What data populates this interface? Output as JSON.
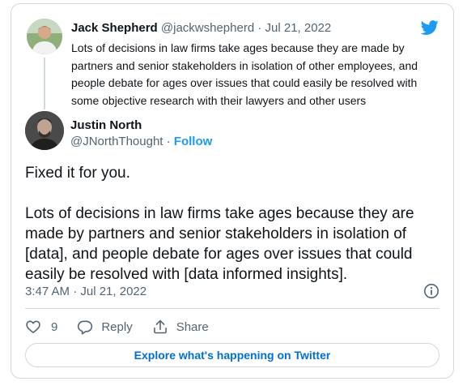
{
  "parent_tweet": {
    "name": "Jack Shepherd",
    "handle": "@jackwshepherd",
    "separator": "·",
    "date": "Jul 21, 2022",
    "text_lines": [
      "Lots of decisions in law firms take ages because they are made by",
      "partners and senior stakeholders in isolation of other employees, and",
      "people debate for ages over issues that could easily be resolved with",
      "some objective research with their lawyers and other users"
    ]
  },
  "main_tweet": {
    "name": "Justin North",
    "handle": "@JNorthThought",
    "separator": "·",
    "follow_label": "Follow",
    "text_lines": [
      "Fixed it for you.",
      "",
      "Lots of decisions in law firms take ages because they are",
      "made by partners and senior stakeholders in isolation of",
      "[data], and people debate for ages over issues that could",
      "easily be resolved with [data informed insights]."
    ],
    "timestamp": "3:47 AM · Jul 21, 2022"
  },
  "actions": {
    "like_count": "9",
    "reply_label": "Reply",
    "share_label": "Share"
  },
  "explore_label": "Explore what's happening on Twitter",
  "icons": {
    "brand": "twitter-bird-icon",
    "info": "info-icon",
    "like": "heart-icon",
    "reply": "reply-bubble-icon",
    "share": "share-upload-icon"
  },
  "colors": {
    "brand_blue": "#1d9bf0",
    "link_blue": "#006fd6",
    "text": "#0f1419",
    "muted": "#536471",
    "border": "#cfd9de"
  }
}
